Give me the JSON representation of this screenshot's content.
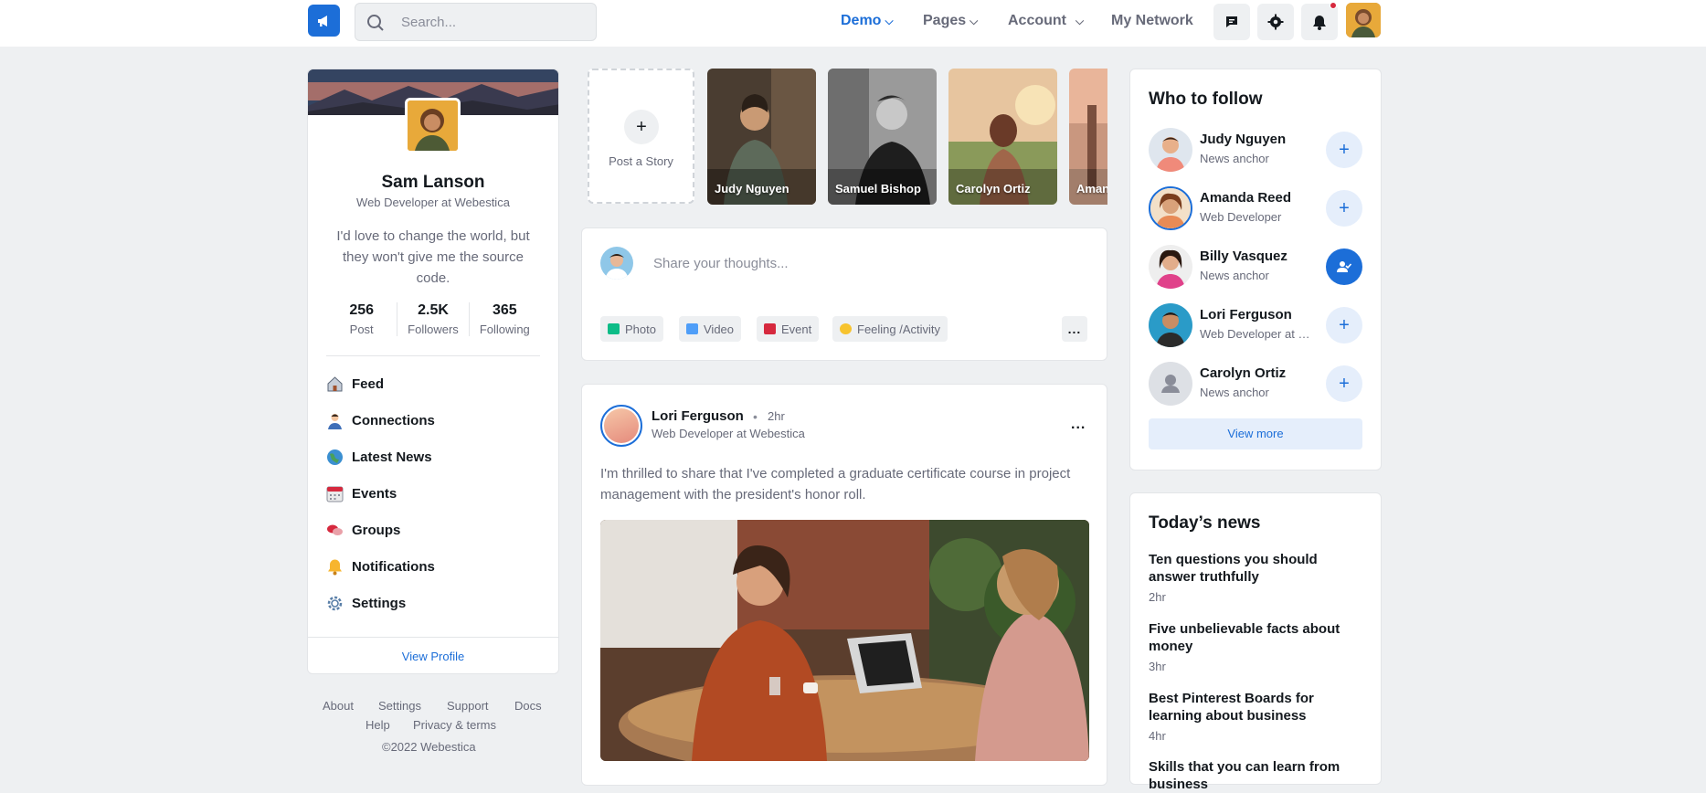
{
  "header": {
    "search_placeholder": "Search...",
    "nav": [
      {
        "label": "Demo",
        "active": true
      },
      {
        "label": "Pages"
      },
      {
        "label": "Account"
      },
      {
        "label": "My Network"
      }
    ],
    "icons": [
      "chat-icon",
      "gear-icon",
      "bell-icon"
    ],
    "accent": "#1c6ed8",
    "notification_dot_color": "#d6293e"
  },
  "profile": {
    "name": "Sam Lanson",
    "role": "Web Developer at Webestica",
    "bio": "I'd love to change the world, but they won't give me the source code.",
    "stats": [
      {
        "value": "256",
        "label": "Post"
      },
      {
        "value": "2.5K",
        "label": "Followers"
      },
      {
        "value": "365",
        "label": "Following"
      }
    ],
    "menu": [
      {
        "label": "Feed",
        "icon": "home-icon"
      },
      {
        "label": "Connections",
        "icon": "person-icon"
      },
      {
        "label": "Latest News",
        "icon": "globe-icon"
      },
      {
        "label": "Events",
        "icon": "calendar-icon"
      },
      {
        "label": "Groups",
        "icon": "chat-bubbles-icon"
      },
      {
        "label": "Notifications",
        "icon": "bell-icon"
      },
      {
        "label": "Settings",
        "icon": "gear-icon"
      }
    ],
    "view_profile": "View Profile"
  },
  "footer": {
    "links": [
      "About",
      "Settings",
      "Support",
      "Docs",
      "Help",
      "Privacy & terms"
    ],
    "copyright": "©2022 Webestica"
  },
  "stories": {
    "add_label": "Post a Story",
    "items": [
      {
        "name": "Judy Nguyen"
      },
      {
        "name": "Samuel Bishop"
      },
      {
        "name": "Carolyn Ortiz"
      },
      {
        "name": "Amanda Reed"
      }
    ]
  },
  "composer": {
    "placeholder": "Share your thoughts...",
    "actions": [
      {
        "label": "Photo",
        "color": "#0cbc87"
      },
      {
        "label": "Video",
        "color": "#4f9ef8"
      },
      {
        "label": "Event",
        "color": "#d6293e"
      },
      {
        "label": "Feeling /Activity",
        "color": "#f7c32e"
      }
    ],
    "more": "..."
  },
  "post": {
    "author": "Lori Ferguson",
    "time": "2hr",
    "dot": "•",
    "role": "Web Developer at Webestica",
    "text": "I'm thrilled to share that I've completed a graduate certificate course in project management with the president's honor roll.",
    "more": "..."
  },
  "who_to_follow": {
    "title": "Who to follow",
    "people": [
      {
        "name": "Judy Nguyen",
        "role": "News anchor",
        "action": "add"
      },
      {
        "name": "Amanda Reed",
        "role": "Web Developer",
        "action": "add"
      },
      {
        "name": "Billy Vasquez",
        "role": "News anchor",
        "action": "followed"
      },
      {
        "name": "Lori Ferguson",
        "role": "Web Developer at Webestica",
        "action": "add"
      },
      {
        "name": "Carolyn Ortiz",
        "role": "News anchor",
        "action": "add"
      }
    ],
    "view_more": "View more"
  },
  "news": {
    "title": "Today’s news",
    "items": [
      {
        "title": "Ten questions you should answer truthfully",
        "time": "2hr"
      },
      {
        "title": "Five unbelievable facts about money",
        "time": "3hr"
      },
      {
        "title": "Best Pinterest Boards for learning about business",
        "time": "4hr"
      },
      {
        "title": "Skills that you can learn from business",
        "time": ""
      }
    ]
  }
}
